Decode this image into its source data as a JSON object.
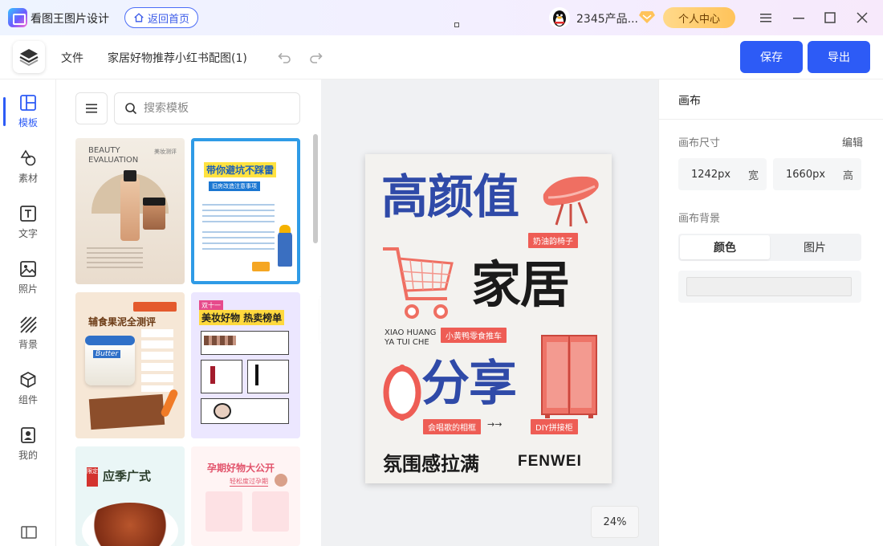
{
  "titlebar": {
    "app_name": "看图王图片设计",
    "home_label": "返回首页",
    "user_name": "2345产品...",
    "personal_center": "个人中心"
  },
  "toolbar": {
    "file_menu": "文件",
    "doc_title": "家居好物推荐小红书配图(1)",
    "save_label": "保存",
    "export_label": "导出"
  },
  "rail": {
    "items": [
      {
        "label": "模板",
        "icon": "template-icon",
        "active": true
      },
      {
        "label": "素材",
        "icon": "shapes-icon"
      },
      {
        "label": "文字",
        "icon": "text-icon"
      },
      {
        "label": "照片",
        "icon": "image-icon"
      },
      {
        "label": "背景",
        "icon": "background-icon"
      },
      {
        "label": "组件",
        "icon": "component-icon"
      },
      {
        "label": "我的",
        "icon": "my-icon"
      }
    ]
  },
  "templates": {
    "search_placeholder": "搜索模板",
    "items": [
      {
        "title": "BEAUTY EVALUATION",
        "subtitle": "美妆测评"
      },
      {
        "title": "带你避坑不踩雷",
        "subtitle": "旧房改造注意事项"
      },
      {
        "title": "辅食果泥全测评",
        "subtitle": "Butter"
      },
      {
        "title": "美妆好物 热卖榜单",
        "subtitle": "双十一"
      },
      {
        "title": "应季广式",
        "subtitle": "限定"
      },
      {
        "title": "孕期好物大公开",
        "subtitle": "轻松度过孕期"
      }
    ]
  },
  "poster": {
    "line1": "高颜值",
    "tag1": "奶油韵椅子",
    "line2": "家居",
    "small_en1": "XIAO HUANG",
    "small_en2": "YA TUI CHE",
    "tag2": "小黄鸭零食推车",
    "line3": "分享",
    "tag3": "会唱歌的相框",
    "arrow": "→→",
    "tag4": "DIY拼接柜",
    "footer_cn": "氛围感拉满",
    "footer_en": "FENWEI",
    "colors": {
      "blue": "#2f4aa8",
      "coral": "#ee5d55",
      "black": "#1a1a1a"
    }
  },
  "canvas": {
    "zoom": "24%"
  },
  "props": {
    "title": "画布",
    "size_label": "画布尺寸",
    "edit_label": "编辑",
    "width_value": "1242px",
    "width_unit": "宽",
    "height_value": "1660px",
    "height_unit": "高",
    "bg_label": "画布背景",
    "tab_color": "颜色",
    "tab_image": "图片"
  },
  "colors": {
    "accent": "#2d5bf6",
    "vip_gold": "#ffc35a"
  }
}
